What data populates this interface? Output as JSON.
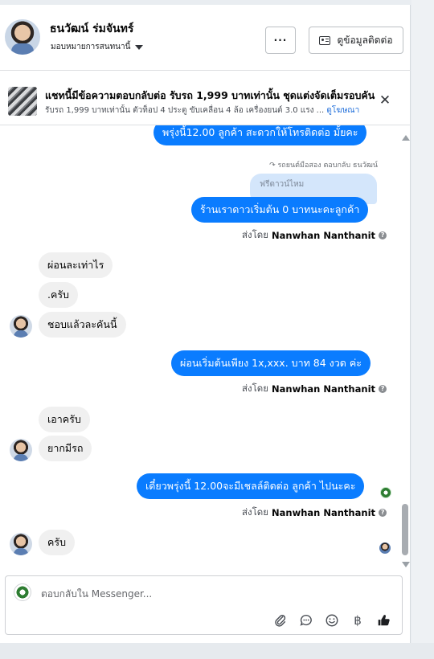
{
  "header": {
    "name": "ธนวัฒน์ ร่มจันทร์",
    "subtitle": "มอบหมายการสนทนานี้",
    "more_label": "···",
    "contact_label": "ดูข้อมูลติดต่อ"
  },
  "ad": {
    "title": "แชทนี้มีข้อความตอบกลับต่อ รับรถ 1,999 บาทเท่านั้น ชุดแต่งจัดเต็มรอบคัน",
    "description": "รับรถ 1,999 บาทเท่านั้น ตัวท็อป 4 ประตู ขับเคลื่อน 4 ล้อ เครื่องยนต์ 3.0 แรง ...",
    "link": "ดูโฆษณา",
    "close": "✕"
  },
  "messages": {
    "m1_text": "พรุ่งนี้12.00 ลูกค้า สะดวกให้โทรติดต่อ มั้ยคะ",
    "reply_note": "↷ รถยนต์มือสอง ตอบกลับ ธนวัฒน์",
    "quote_text": "ฟรีดาวน์ไหม",
    "m2_text": "ร้านเราดาวเริ่มต้น  0 บาทนะคะลูกค้า",
    "sent_by_prefix": "ส่งโดย",
    "sender_name": "Nanwhan Nanthanit",
    "in1_text": "ผ่อนละเท่าไร",
    "in2_text": ".ครับ",
    "in3_text": "ชอบแล้วละคันนี้",
    "m3_text": "ผ่อนเริ่มต้นเพียง 1x,xxx. บาท 84 งวด ค่ะ",
    "in4_text": "เอาครับ",
    "in5_text": "ยากมีรถ",
    "m4_text": "เดี๋ยวพรุ่งนี้ 12.00จะมีเชลล์ติดต่อ ลูกค้า ไปนะคะ",
    "in6_text": "ครับ"
  },
  "composer": {
    "placeholder": "ตอบกลับใน Messenger...",
    "icons": [
      "paperclip-icon",
      "chat-bubble-icon",
      "emoji-icon",
      "baht-icon",
      "thumbs-up-icon"
    ],
    "baht_symbol": "฿"
  },
  "colors": {
    "outgoing_bubble": "#0a7cff",
    "incoming_bubble": "#f0f0f0",
    "link": "#216fdb"
  }
}
